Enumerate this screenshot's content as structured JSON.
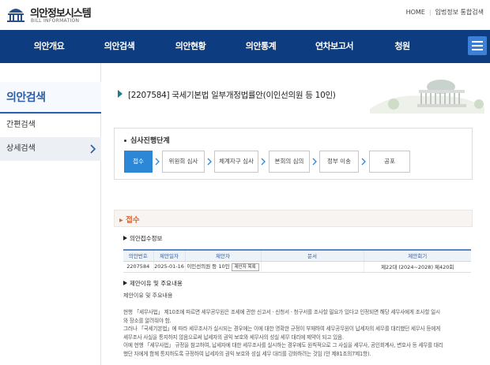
{
  "site": {
    "logo_title": "의안정보시스템",
    "logo_sub": "BILL INFORMATION",
    "util_links": [
      "HOME",
      "입법정보 통합검색"
    ]
  },
  "nav": {
    "items": [
      "의안개요",
      "의안검색",
      "의안현황",
      "의안통계",
      "연차보고서",
      "청원"
    ],
    "menu_icon": "hamburger-icon"
  },
  "sidebar": {
    "title": "의안검색",
    "items": [
      {
        "label": "간편검색",
        "active": false
      },
      {
        "label": "상세검색",
        "active": true
      }
    ]
  },
  "bill": {
    "title": "[2207584] 국세기본법 일부개정법률안(이인선의원 등 10인)"
  },
  "stage": {
    "label": "심사진행단계",
    "steps": [
      "접수",
      "위원회 심사",
      "체계자구 심사",
      "본회의 심의",
      "정부 이송",
      "공포"
    ],
    "active_index": 0
  },
  "reception": {
    "section_title": "접수",
    "info_heading": "의안접수정보",
    "columns": [
      "의안번호",
      "제안일자",
      "제안자",
      "문서",
      "제안회기"
    ],
    "row": {
      "bill_no": "2207584",
      "date": "2025-01-16",
      "proposer": "이인선의원 등 10인",
      "proposer_btn": "제안자 목록",
      "document": "",
      "session": "제22대 (2024~2028) 제420회"
    },
    "reason_heading": "제안이유 및 주요내용",
    "reason_plain": "제안이유 및 주요내용",
    "reason_lines": [
      "현행 「세무사법」 제10조에 따르면 세무공무원은 조세에 관한 신고서 · 신청서 · 청구서를 조사할 필요가 있다고 인정되면 해당 세무사에게 조사할 일시",
      "와 장소를 알려줘야 함.",
      "그러나 「국세기본법」에 따라 세무조사가 실시되는 경우에는 이에 대한 명확한 규정이 부재하여 세무공무원이 납세자의 세무를 대리했던 세무사 등에게",
      "세무조사 사실을 통지하지 않음으로써 납세자의 권익 보호와 세무사의 성실 세무 대리에 제약이 되고 있음.",
      "이에 현행 「세무사법」 규정을 참고하여, 납세자에 대한 세무조사를 실시하는 경우에도 원칙적으로 그 사실을 세무사, 공인회계사, 변호사 등 세무를 대리",
      "했던 자에게 함께 통지하도록 규정하여 납세자의 권익 보호와 성실 세무 대리를 강화하려는 것임 (안 제81조의7제1항)."
    ]
  }
}
